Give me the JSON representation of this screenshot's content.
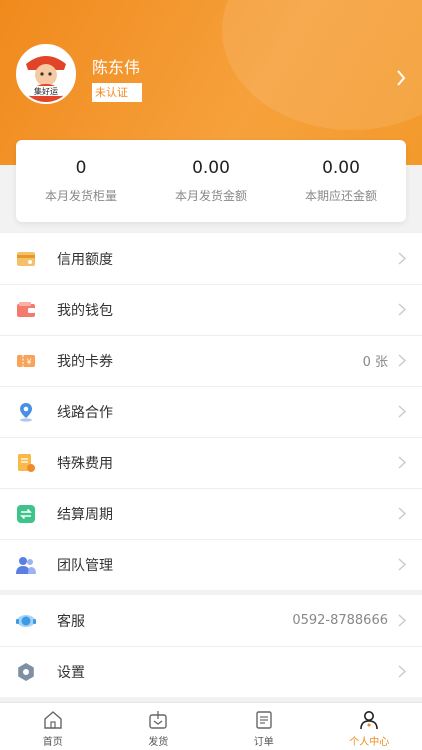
{
  "header": {
    "username": "陈东伟",
    "badge": "未认证"
  },
  "stats": [
    {
      "value": "0",
      "label": "本月发货柜量"
    },
    {
      "value": "0.00",
      "label": "本月发货金额"
    },
    {
      "value": "0.00",
      "label": "本期应还金额"
    }
  ],
  "menu": [
    {
      "label": "信用额度",
      "icon": "credit-icon"
    },
    {
      "label": "我的钱包",
      "icon": "wallet-icon"
    },
    {
      "label": "我的卡券",
      "icon": "coupon-icon",
      "right": "0 张"
    },
    {
      "label": "线路合作",
      "icon": "route-icon"
    },
    {
      "label": "特殊费用",
      "icon": "fee-icon"
    },
    {
      "label": "结算周期",
      "icon": "settlement-icon"
    },
    {
      "label": "团队管理",
      "icon": "team-icon"
    }
  ],
  "menu2": [
    {
      "label": "客服",
      "icon": "service-icon",
      "right": "0592-8788666"
    },
    {
      "label": "设置",
      "icon": "settings-icon"
    }
  ],
  "tabs": [
    {
      "label": "首页",
      "icon": "home-icon"
    },
    {
      "label": "发货",
      "icon": "ship-icon"
    },
    {
      "label": "订单",
      "icon": "order-icon"
    },
    {
      "label": "个人中心",
      "icon": "profile-icon",
      "active": true
    }
  ],
  "colors": {
    "accent": "#f08a1d"
  }
}
